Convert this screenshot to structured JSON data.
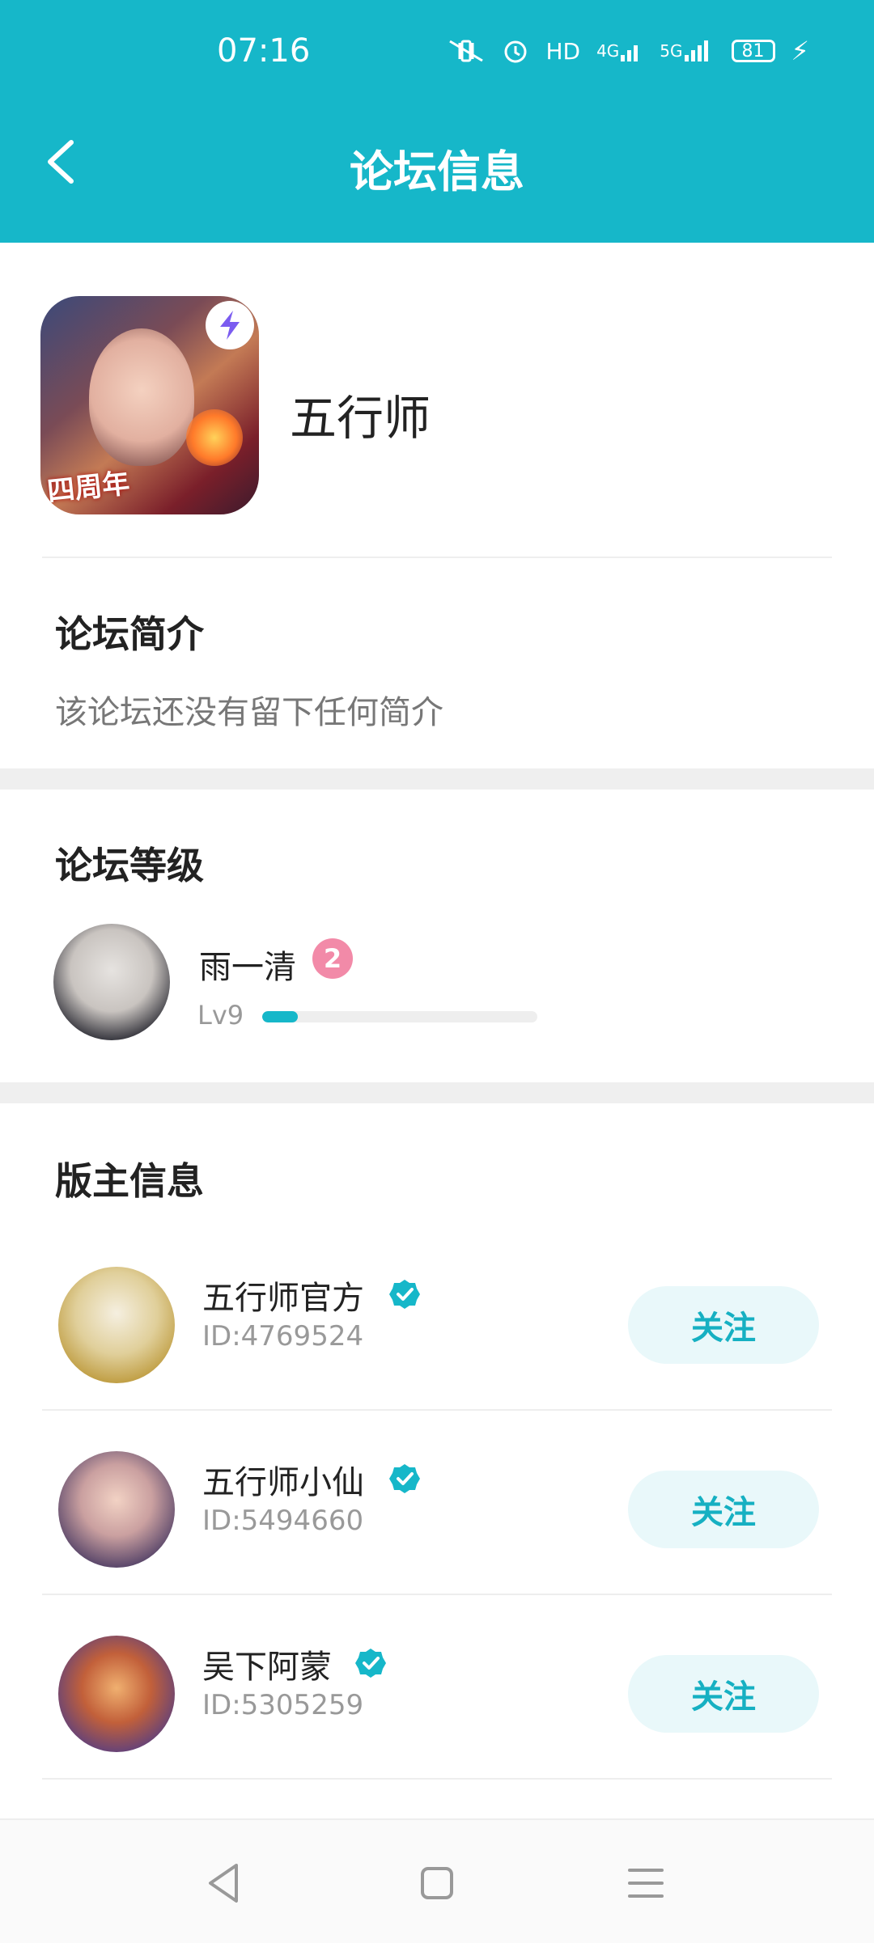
{
  "status_bar": {
    "time": "07:16",
    "indicators": [
      "mute-vibrate-icon",
      "alarm-icon",
      "HD",
      "4G",
      "5G"
    ],
    "battery": "81"
  },
  "header": {
    "back_icon": "chevron-left-icon",
    "title": "论坛信息"
  },
  "forum": {
    "name": "五行师",
    "icon_banner": "四周年"
  },
  "intro": {
    "title": "论坛简介",
    "text": "该论坛还没有留下任何简介"
  },
  "level": {
    "title": "论坛等级",
    "user_name": "雨一清",
    "badge": "2",
    "level_label": "Lv9",
    "progress": 0.13
  },
  "moderators": {
    "title": "版主信息",
    "items": [
      {
        "name": "五行师官方",
        "id": "ID:4769524",
        "follow_label": "关注",
        "verified": true
      },
      {
        "name": "五行师小仙",
        "id": "ID:5494660",
        "follow_label": "关注",
        "verified": true
      },
      {
        "name": "吴下阿蒙",
        "id": "ID:5305259",
        "follow_label": "关注",
        "verified": true
      }
    ]
  },
  "navbar": {
    "icons": [
      "back-triangle-icon",
      "home-square-icon",
      "menu-lines-icon"
    ]
  },
  "colors": {
    "accent": "#16b7c9",
    "follow_bg": "#e9f8fa",
    "badge_pink": "#f28aa8"
  }
}
